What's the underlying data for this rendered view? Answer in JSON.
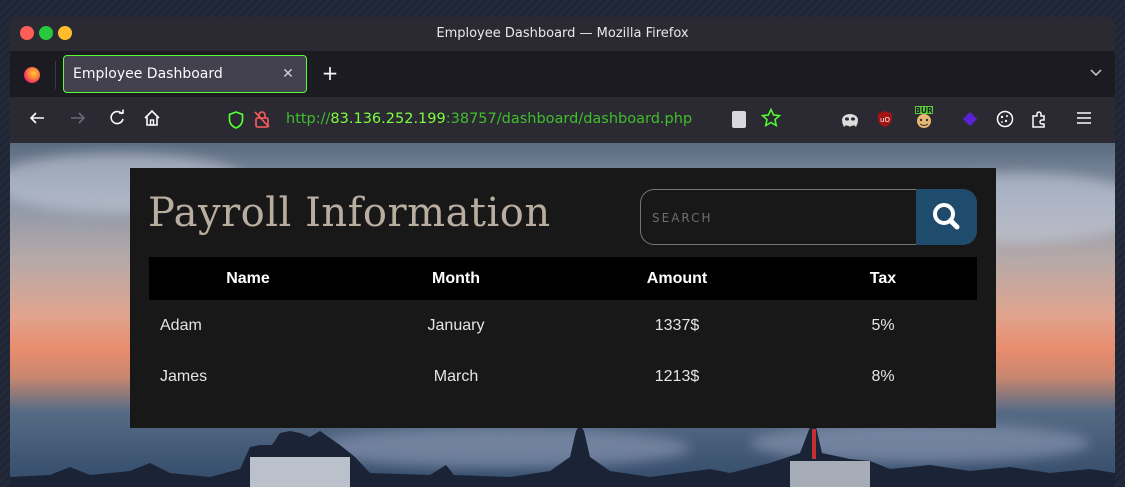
{
  "window": {
    "title": "Employee Dashboard — Mozilla Firefox"
  },
  "tabs": [
    {
      "label": "Employee Dashboard",
      "active": true
    }
  ],
  "navbar": {
    "url_scheme": "http://",
    "url_host": "83.136.252.199",
    "url_rest": ":38757/dashboard/dashboard.php",
    "icons": [
      "back-arrow-icon",
      "forward-arrow-icon",
      "reload-icon",
      "home-icon",
      "shield-icon",
      "insecure-lock-icon",
      "reader-view-icon",
      "bookmark-star-icon",
      "menu-icon"
    ],
    "extensions": [
      "ghost-extension-icon",
      "ublock-origin-icon",
      "burp-extension-icon",
      "diamond-extension-icon",
      "cookie-extension-icon",
      "puzzle-extension-icon"
    ]
  },
  "page": {
    "title": "Payroll Information",
    "search": {
      "placeholder": "SEARCH",
      "value": ""
    },
    "table": {
      "headers": [
        "Name",
        "Month",
        "Amount",
        "Tax"
      ],
      "rows": [
        [
          "Adam",
          "January",
          "1337$",
          "5%"
        ],
        [
          "James",
          "March",
          "1213$",
          "8%"
        ]
      ]
    }
  },
  "colors": {
    "tab_border": "#54ff32",
    "url_host": "#7cff3a",
    "panel_bg": "#181818",
    "search_button": "#1f4c6c",
    "title_text": "#b9ada0"
  }
}
